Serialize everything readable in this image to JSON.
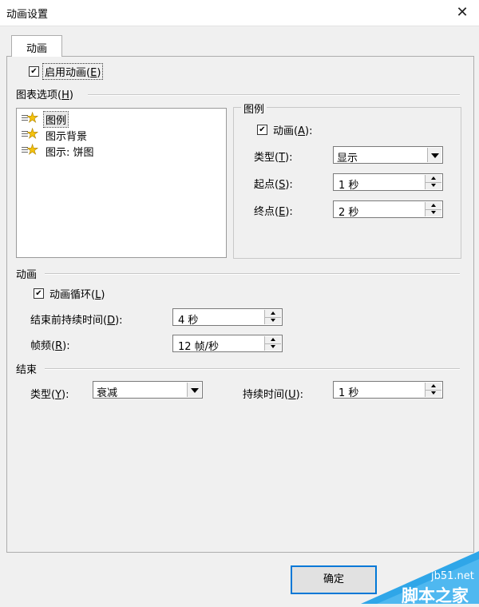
{
  "window": {
    "title": "动画设置",
    "close_glyph": "✕"
  },
  "tab": {
    "label": "动画"
  },
  "enable": {
    "label": "启用动画",
    "key": "E",
    "checked": true
  },
  "chart_options": {
    "label": "图表选项",
    "key": "H",
    "items": [
      "图例",
      "图示背景",
      "图示: 饼图"
    ],
    "selected_index": 0
  },
  "legend_group": {
    "title": "图例",
    "anim_checkbox": {
      "label": "动画",
      "key": "A",
      "checked": true
    },
    "type": {
      "label": "类型",
      "key": "T",
      "value": "显示"
    },
    "start": {
      "label": "起点",
      "key": "S",
      "value": "1 秒"
    },
    "end": {
      "label": "终点",
      "key": "E",
      "value": "2 秒"
    }
  },
  "animation_section": {
    "label": "动画",
    "loop": {
      "label": "动画循环",
      "key": "L",
      "checked": true
    },
    "duration_before_end": {
      "label": "结束前持续时间",
      "key": "D",
      "value": "4 秒"
    },
    "frame_rate": {
      "label": "帧频",
      "key": "R",
      "value": "12 帧/秒"
    }
  },
  "end_section": {
    "label": "结束",
    "type": {
      "label": "类型",
      "key": "Y",
      "value": "衰减"
    },
    "duration": {
      "label": "持续时间",
      "key": "U",
      "value": "1 秒"
    }
  },
  "buttons": {
    "ok": "确定"
  },
  "watermark": {
    "site": "jb51.net",
    "name": "脚本之家"
  },
  "colors": {
    "accent": "#0078d7",
    "watermark": "#2fa6e8",
    "star": "#f4c20d"
  },
  "icons": {
    "close": "close-icon",
    "tree_item": "star-list-icon",
    "check": "checkmark-icon"
  }
}
